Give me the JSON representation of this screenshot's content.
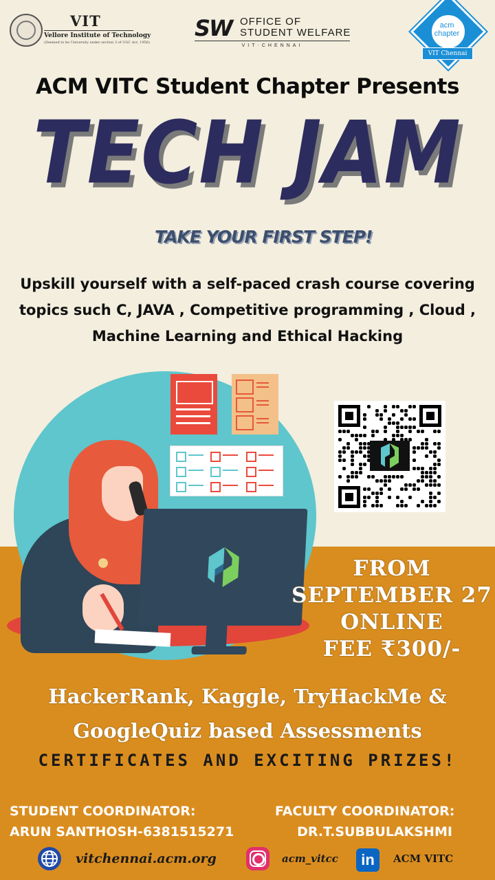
{
  "header": {
    "vit_name": "VIT",
    "vit_full": "Vellore Institute of Technology",
    "vit_deemed": "(Deemed to be University under section 3 of UGC Act, 1956)",
    "sw_mark": "SW",
    "sw_line1": "OFFICE OF",
    "sw_line2": "STUDENT WELFARE",
    "sw_sub": "VIT·CHENNAI",
    "acm_line1": "acm",
    "acm_line2": "chapter",
    "acm_ribbon": "VIT Chennai"
  },
  "presents": "ACM VITC Student Chapter Presents",
  "title": "TECH JAM",
  "tagline": "TAKE YOUR FIRST STEP!",
  "description": "Upskill yourself with a self-paced crash course covering topics such C, JAVA , Competitive programming , Cloud , Machine Learning and Ethical Hacking",
  "event": {
    "line1": "FROM",
    "line2": "SEPTEMBER 27",
    "line3": "ONLINE",
    "line4": "FEE  ₹300/-"
  },
  "assessments": {
    "line1": "HackerRank, Kaggle, TryHackMe &",
    "line2": "GoogleQuiz based Assessments"
  },
  "certificates": "CERTIFICATES AND EXCITING PRIZES!",
  "student_coordinator": {
    "label": "STUDENT COORDINATOR:",
    "name": "ARUN SANTHOSH-6381515271"
  },
  "faculty_coordinator": {
    "label": "FACULTY COORDINATOR:",
    "name": "DR.T.SUBBULAKSHMI"
  },
  "footer": {
    "website": "vitchennai.acm.org",
    "instagram": "acm_vitcc",
    "linkedin_icon": "in",
    "linkedin": "ACM VITC"
  },
  "icons": {
    "website": "globe-icon",
    "instagram": "instagram-icon",
    "linkedin": "linkedin-icon"
  },
  "colors": {
    "background": "#f3eede",
    "orange": "#da8d1f",
    "title": "#2c2c5e",
    "teal": "#5ec6cc",
    "red": "#ea4a3c"
  }
}
